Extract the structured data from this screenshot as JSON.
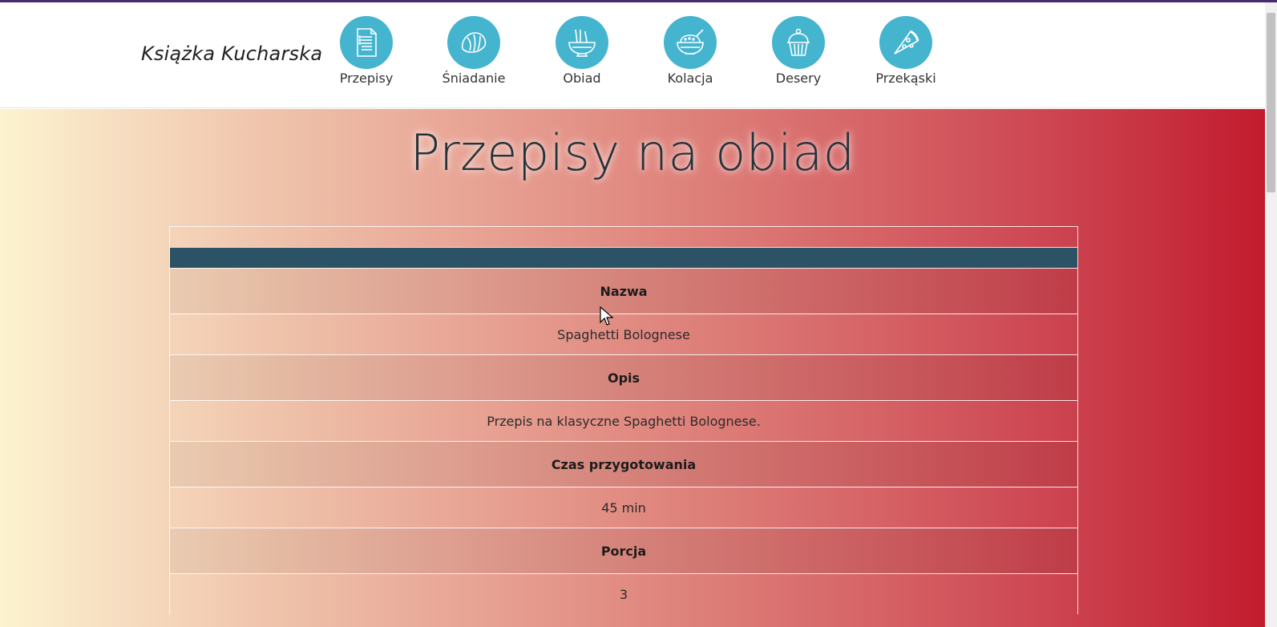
{
  "brand": "Książka Kucharska",
  "nav": [
    {
      "label": "Przepisy",
      "icon": "recipe-document-icon"
    },
    {
      "label": "Śniadanie",
      "icon": "croissant-icon"
    },
    {
      "label": "Obiad",
      "icon": "noodle-bowl-icon"
    },
    {
      "label": "Kolacja",
      "icon": "rice-bowl-icon"
    },
    {
      "label": "Desery",
      "icon": "cupcake-icon"
    },
    {
      "label": "Przekąski",
      "icon": "pizza-slice-icon"
    }
  ],
  "page_title": "Przepisy na obiad",
  "recipe_table": {
    "name_header": "Nazwa",
    "name_value": "Spaghetti Bolognese",
    "description_header": "Opis",
    "description_value": "Przepis na klasyczne Spaghetti Bolognese.",
    "prep_time_header": "Czas przygotowania",
    "prep_time_value": "45 min",
    "servings_header": "Porcja",
    "servings_value": "3"
  },
  "colors": {
    "nav_circle": "#45b4cf",
    "table_bar": "#2c5265",
    "gradient_start": "#fdf3cf",
    "gradient_end": "#c21c2e"
  }
}
